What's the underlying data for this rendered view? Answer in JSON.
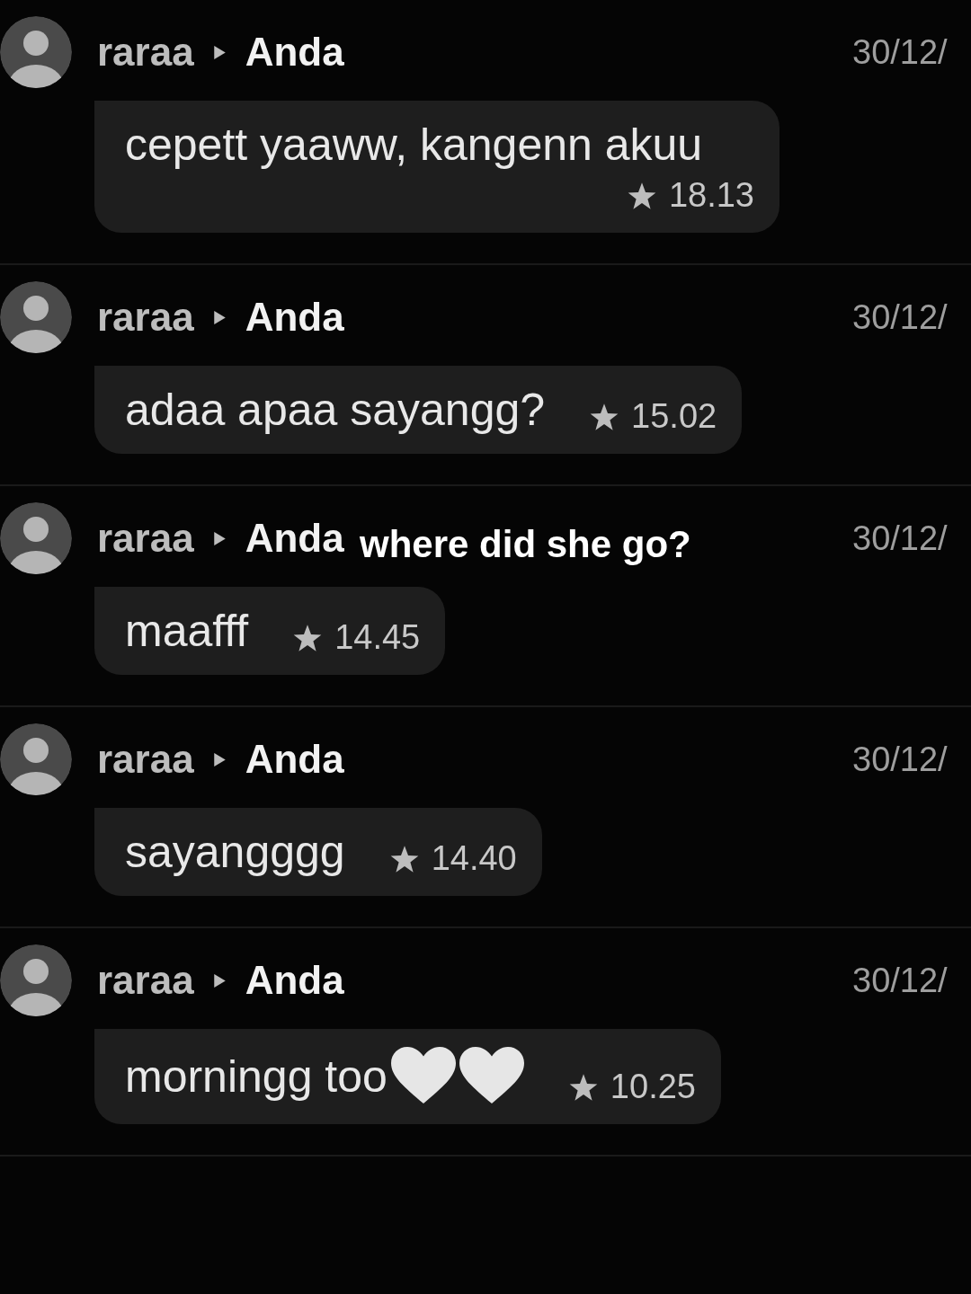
{
  "messages": [
    {
      "sender": "raraa",
      "recipient": "Anda",
      "date": "30/12/",
      "text": "cepett yaaww, kangenn akuu",
      "starred": true,
      "time": "18.13"
    },
    {
      "sender": "raraa",
      "recipient": "Anda",
      "date": "30/12/",
      "text": "adaa apaa sayangg?",
      "starred": true,
      "time": "15.02"
    },
    {
      "sender": "raraa",
      "recipient": "Anda",
      "date": "30/12/",
      "text": "maafff",
      "starred": true,
      "time": "14.45"
    },
    {
      "sender": "raraa",
      "recipient": "Anda",
      "date": "30/12/",
      "text": "sayangggg",
      "starred": true,
      "time": "14.40"
    },
    {
      "sender": "raraa",
      "recipient": "Anda",
      "date": "30/12/",
      "text": "morningg too",
      "emoji": [
        {
          "kind": "heart"
        },
        {
          "kind": "heart"
        }
      ],
      "starred": true,
      "time": "10.25"
    }
  ],
  "caption": {
    "text": "where did she go?"
  }
}
